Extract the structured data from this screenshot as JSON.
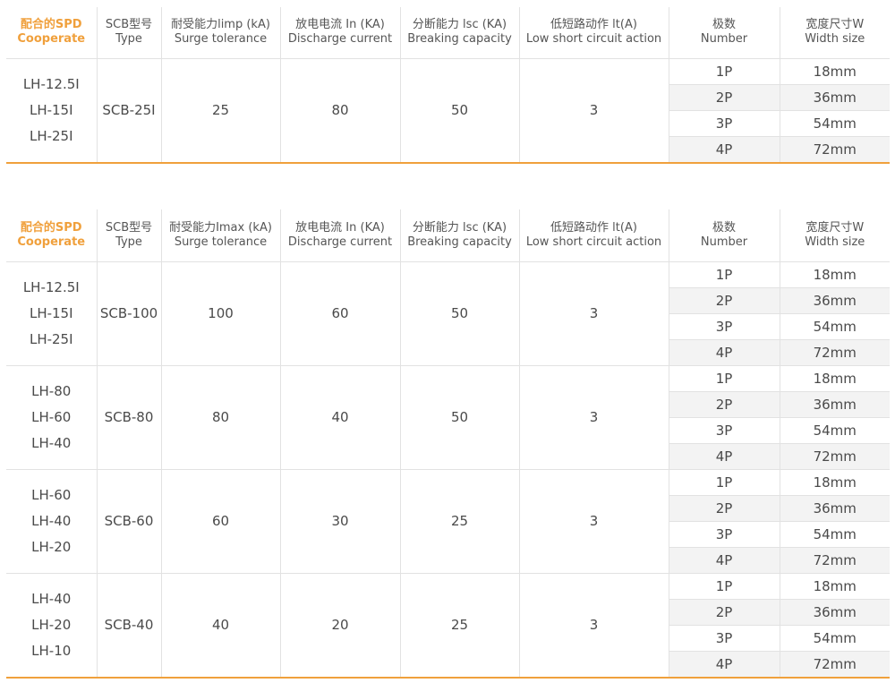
{
  "tables": [
    {
      "headers": [
        {
          "zh": "配合的SPD",
          "en": "Cooperate"
        },
        {
          "zh": "SCB型号",
          "en": "Type"
        },
        {
          "zh": "耐受能力limp (kA)",
          "en": "Surge tolerance"
        },
        {
          "zh": "放电电流 In (KA)",
          "en": "Discharge current"
        },
        {
          "zh": "分断能力 lsc (KA)",
          "en": "Breaking capacity"
        },
        {
          "zh": "低短路动作 lt(A)",
          "en": "Low short circuit action"
        },
        {
          "zh": "极数",
          "en": "Number"
        },
        {
          "zh": "宽度尺寸W",
          "en": "Width size"
        }
      ],
      "groups": [
        {
          "spd": [
            "LH-12.5I",
            "LH-15I",
            "LH-25I"
          ],
          "type": "SCB-25I",
          "surge": "25",
          "discharge": "80",
          "breaking": "50",
          "low_short": "3",
          "rows": [
            {
              "poles": "1P",
              "width": "18mm"
            },
            {
              "poles": "2P",
              "width": "36mm"
            },
            {
              "poles": "3P",
              "width": "54mm"
            },
            {
              "poles": "4P",
              "width": "72mm"
            }
          ]
        }
      ]
    },
    {
      "headers": [
        {
          "zh": "配合的SPD",
          "en": "Cooperate"
        },
        {
          "zh": "SCB型号",
          "en": "Type"
        },
        {
          "zh": "耐受能力Imax (kA)",
          "en": "Surge tolerance"
        },
        {
          "zh": "放电电流 In (KA)",
          "en": "Discharge current"
        },
        {
          "zh": "分断能力 lsc (KA)",
          "en": "Breaking capacity"
        },
        {
          "zh": "低短路动作 lt(A)",
          "en": "Low short circuit action"
        },
        {
          "zh": "极数",
          "en": "Number"
        },
        {
          "zh": "宽度尺寸W",
          "en": "Width size"
        }
      ],
      "groups": [
        {
          "spd": [
            "LH-12.5I",
            "LH-15I",
            "LH-25I"
          ],
          "type": "SCB-100",
          "surge": "100",
          "discharge": "60",
          "breaking": "50",
          "low_short": "3",
          "rows": [
            {
              "poles": "1P",
              "width": "18mm"
            },
            {
              "poles": "2P",
              "width": "36mm"
            },
            {
              "poles": "3P",
              "width": "54mm"
            },
            {
              "poles": "4P",
              "width": "72mm"
            }
          ]
        },
        {
          "spd": [
            "LH-80",
            "LH-60",
            "LH-40"
          ],
          "type": "SCB-80",
          "surge": "80",
          "discharge": "40",
          "breaking": "50",
          "low_short": "3",
          "rows": [
            {
              "poles": "1P",
              "width": "18mm"
            },
            {
              "poles": "2P",
              "width": "36mm"
            },
            {
              "poles": "3P",
              "width": "54mm"
            },
            {
              "poles": "4P",
              "width": "72mm"
            }
          ]
        },
        {
          "spd": [
            "LH-60",
            "LH-40",
            "LH-20"
          ],
          "type": "SCB-60",
          "surge": "60",
          "discharge": "30",
          "breaking": "25",
          "low_short": "3",
          "rows": [
            {
              "poles": "1P",
              "width": "18mm"
            },
            {
              "poles": "2P",
              "width": "36mm"
            },
            {
              "poles": "3P",
              "width": "54mm"
            },
            {
              "poles": "4P",
              "width": "72mm"
            }
          ]
        },
        {
          "spd": [
            "LH-40",
            "LH-20",
            "LH-10"
          ],
          "type": "SCB-40",
          "surge": "40",
          "discharge": "20",
          "breaking": "25",
          "low_short": "3",
          "rows": [
            {
              "poles": "1P",
              "width": "18mm"
            },
            {
              "poles": "2P",
              "width": "36mm"
            },
            {
              "poles": "3P",
              "width": "54mm"
            },
            {
              "poles": "4P",
              "width": "72mm"
            }
          ]
        }
      ]
    }
  ],
  "colors": {
    "accent": "#f0a03c",
    "row_alt": "#f3f3f3",
    "group_alt": "#f7f7f7",
    "border": "#e2e2e2"
  }
}
